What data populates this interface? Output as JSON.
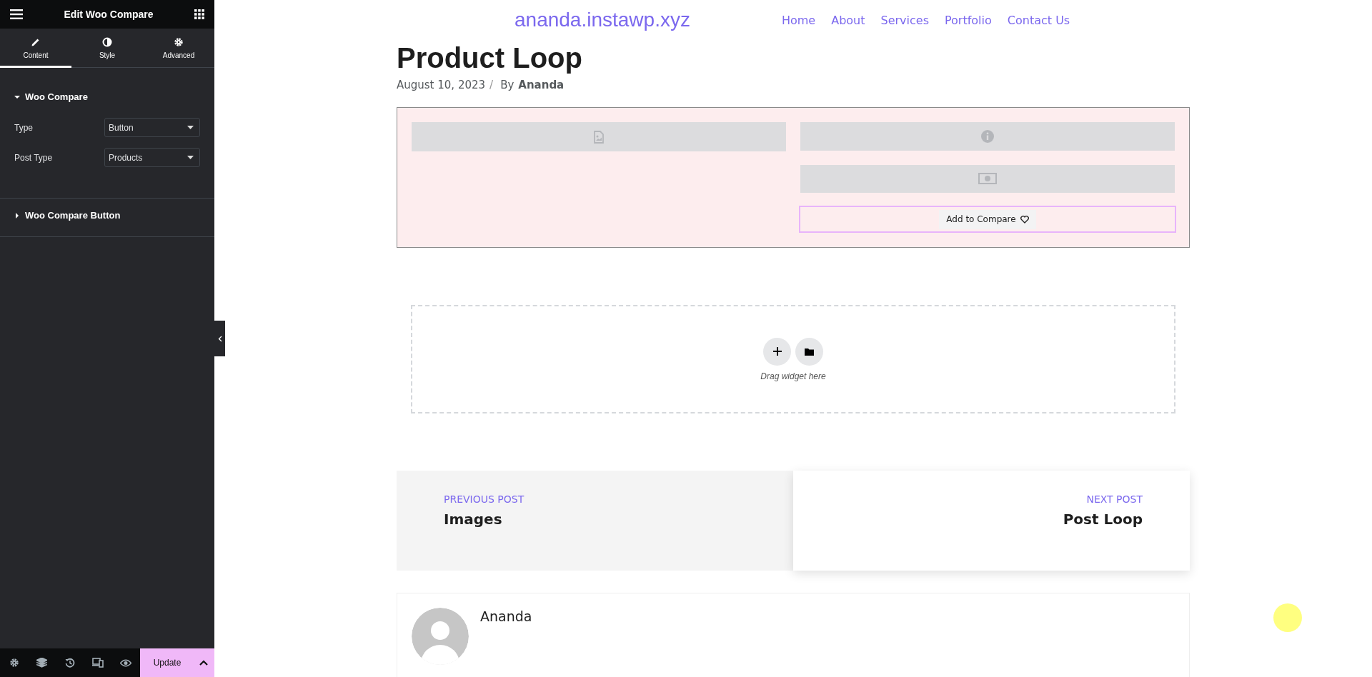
{
  "panel": {
    "title": "Edit Woo Compare",
    "tabs": [
      {
        "label": "Content",
        "selected": true
      },
      {
        "label": "Style",
        "selected": false
      },
      {
        "label": "Advanced",
        "selected": false
      }
    ],
    "sections": [
      {
        "title": "Woo Compare",
        "expanded": true,
        "controls": [
          {
            "label": "Type",
            "value": "Button"
          },
          {
            "label": "Post Type",
            "value": "Products"
          }
        ]
      },
      {
        "title": "Woo Compare Button",
        "expanded": false
      }
    ],
    "footer": {
      "update": "Update"
    }
  },
  "site": {
    "title": "ananda.instawp.xyz",
    "nav": [
      "Home",
      "About",
      "Services",
      "Portfolio",
      "Contact Us"
    ]
  },
  "post": {
    "title": "Product Loop",
    "date": "August 10, 2023",
    "separator": "/",
    "by": "By",
    "author": "Ananda"
  },
  "product": {
    "compare_button": "Add to Compare"
  },
  "drop_zone": {
    "text": "Drag widget here"
  },
  "post_nav": [
    {
      "label": "PREVIOUS POST",
      "title": "Images"
    },
    {
      "label": "NEXT POST",
      "title": "Post Loop"
    }
  ],
  "author_box": {
    "name": "Ananda"
  }
}
